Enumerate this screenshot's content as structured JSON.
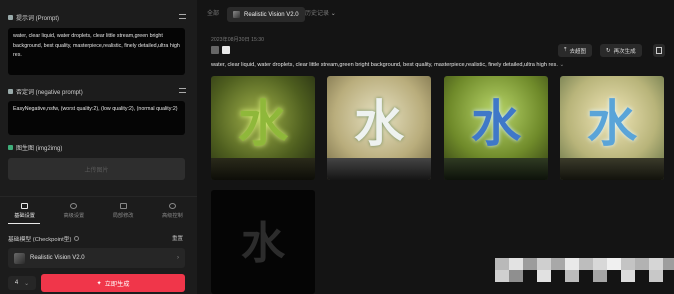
{
  "left": {
    "prompt_title": "提示词 (Prompt)",
    "prompt_text": "water, clear liquid, water droplets, clear little stream,green bright background, best quality, masterpiece,realistic, finely detailed,ultra high res.",
    "negative_title": "否定词 (negative prompt)",
    "negative_text": "EasyNegative,nsfw, (worst quality:2), (low quality:2), (normal quality:2)",
    "i2i_title": "图生图 (img2img)",
    "i2i_button": "上传图片",
    "tabs": [
      {
        "label": "基础设置",
        "icon": "sliders-icon"
      },
      {
        "label": "高级设置",
        "icon": "target-icon"
      },
      {
        "label": "局部修改",
        "icon": "brush-icon"
      },
      {
        "label": "高级控制",
        "icon": "control-icon"
      }
    ],
    "checkpoint_label": "基础模型 (Checkpoint型)",
    "reset_label": "重置",
    "checkpoint_value": "Realistic Vision V2.0",
    "count": "4",
    "generate_label": "立即生成"
  },
  "right": {
    "tab_left": "全部",
    "active_tab": "Realistic Vision V2.0",
    "tab_right": "历史记录",
    "timestamp": "2023年08月30日 15:30",
    "btn_upscale": "去超图",
    "btn_redraw": "再次生成",
    "prompt": "water, clear liquid, water droplets, clear little stream,green bright background, best quality, masterpiece,realistic, finely detailed,ultra high res.",
    "glyph": "水"
  },
  "colors": {
    "accent": "#f0364a",
    "panel": "#1c1c1c",
    "bg": "#141414"
  }
}
